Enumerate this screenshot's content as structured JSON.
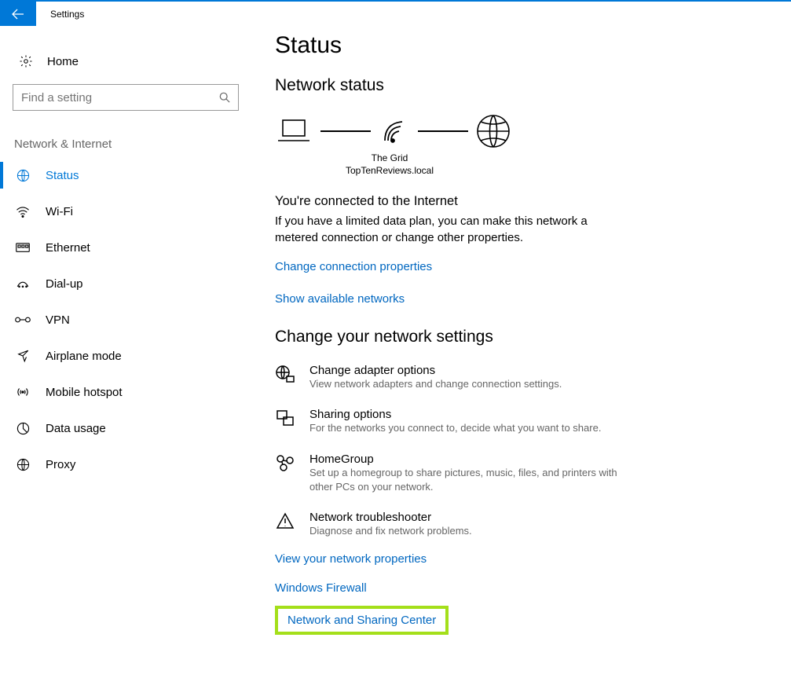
{
  "app": {
    "title": "Settings"
  },
  "sidebar": {
    "home": "Home",
    "search_placeholder": "Find a setting",
    "section": "Network & Internet",
    "items": [
      {
        "label": "Status",
        "active": true
      },
      {
        "label": "Wi-Fi"
      },
      {
        "label": "Ethernet"
      },
      {
        "label": "Dial-up"
      },
      {
        "label": "VPN"
      },
      {
        "label": "Airplane mode"
      },
      {
        "label": "Mobile hotspot"
      },
      {
        "label": "Data usage"
      },
      {
        "label": "Proxy"
      }
    ]
  },
  "main": {
    "title": "Status",
    "network_status_heading": "Network status",
    "diagram": {
      "network_name": "The Grid",
      "domain": "TopTenReviews.local"
    },
    "connected": {
      "title": "You're connected to the Internet",
      "body": "If you have a limited data plan, you can make this network a metered connection or change other properties."
    },
    "links": {
      "change_connection": "Change connection properties",
      "show_networks": "Show available networks",
      "view_properties": "View your network properties",
      "firewall": "Windows Firewall",
      "sharing_center": "Network and Sharing Center"
    },
    "change_settings_heading": "Change your network settings",
    "settings": [
      {
        "title": "Change adapter options",
        "desc": "View network adapters and change connection settings."
      },
      {
        "title": "Sharing options",
        "desc": "For the networks you connect to, decide what you want to share."
      },
      {
        "title": "HomeGroup",
        "desc": "Set up a homegroup to share pictures, music, files, and printers with other PCs on your network."
      },
      {
        "title": "Network troubleshooter",
        "desc": "Diagnose and fix network problems."
      }
    ]
  }
}
